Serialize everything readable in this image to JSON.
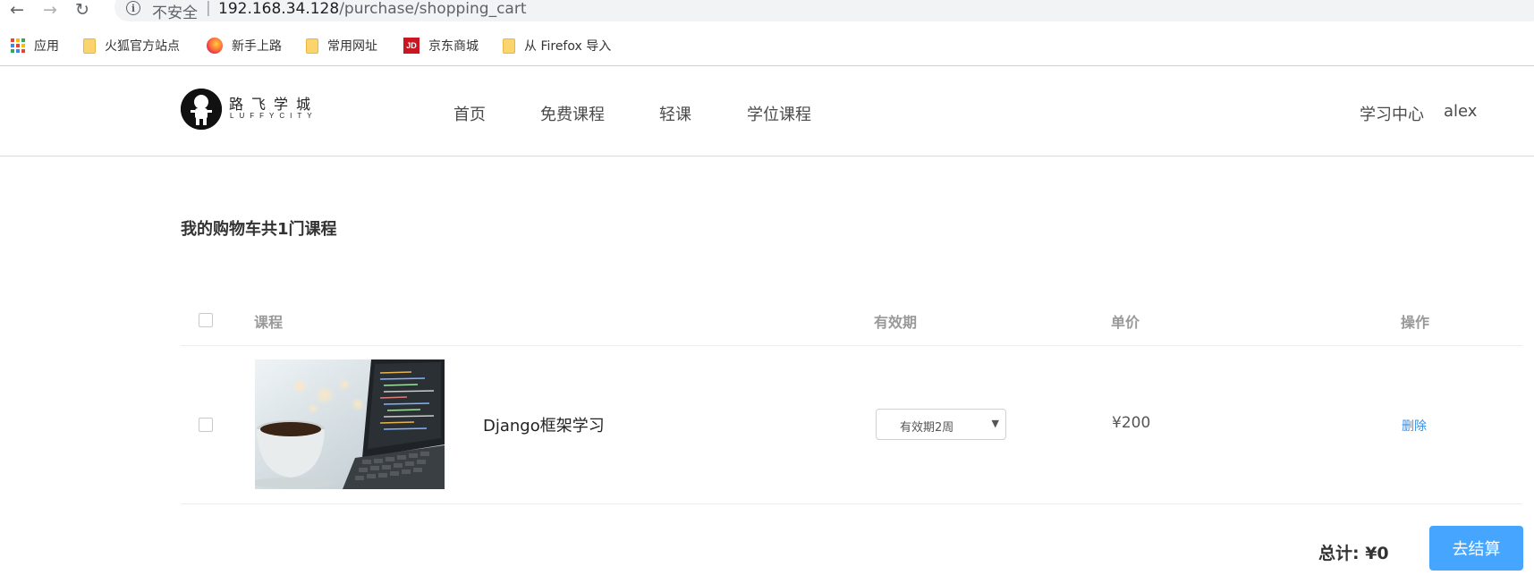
{
  "browser": {
    "address": {
      "insecure_label": "不安全",
      "separator": "|",
      "host": "192.168.34.128",
      "path": "/purchase/shopping_cart"
    },
    "bookmarks": [
      {
        "label": "应用",
        "icon": "apps-grid-icon"
      },
      {
        "label": "火狐官方站点",
        "icon": "folder-icon"
      },
      {
        "label": "新手上路",
        "icon": "firefox-icon"
      },
      {
        "label": "常用网址",
        "icon": "folder-icon"
      },
      {
        "label": "京东商城",
        "icon": "jd-icon",
        "icon_text": "JD"
      },
      {
        "label": "从 Firefox 导入",
        "icon": "folder-icon"
      }
    ]
  },
  "site": {
    "logo": {
      "cn": "路飞学城",
      "en": "LUFFYCITY"
    },
    "nav": [
      {
        "label": "首页"
      },
      {
        "label": "免费课程"
      },
      {
        "label": "轻课"
      },
      {
        "label": "学位课程"
      }
    ],
    "user": {
      "center_label": "学习中心",
      "username": "alex"
    }
  },
  "cart": {
    "title": "我的购物车共1门课程",
    "headers": {
      "course": "课程",
      "validity": "有效期",
      "price": "单价",
      "action": "操作"
    },
    "items": [
      {
        "name": "Django框架学习",
        "validity": "有效期2周",
        "price": "¥200",
        "action_label": "删除"
      }
    ],
    "total_label": "总计: ¥0",
    "checkout_label": "去结算"
  },
  "colors": {
    "accent": "#46a6ff",
    "link": "#3a8ee6",
    "header_text": "#999999"
  }
}
